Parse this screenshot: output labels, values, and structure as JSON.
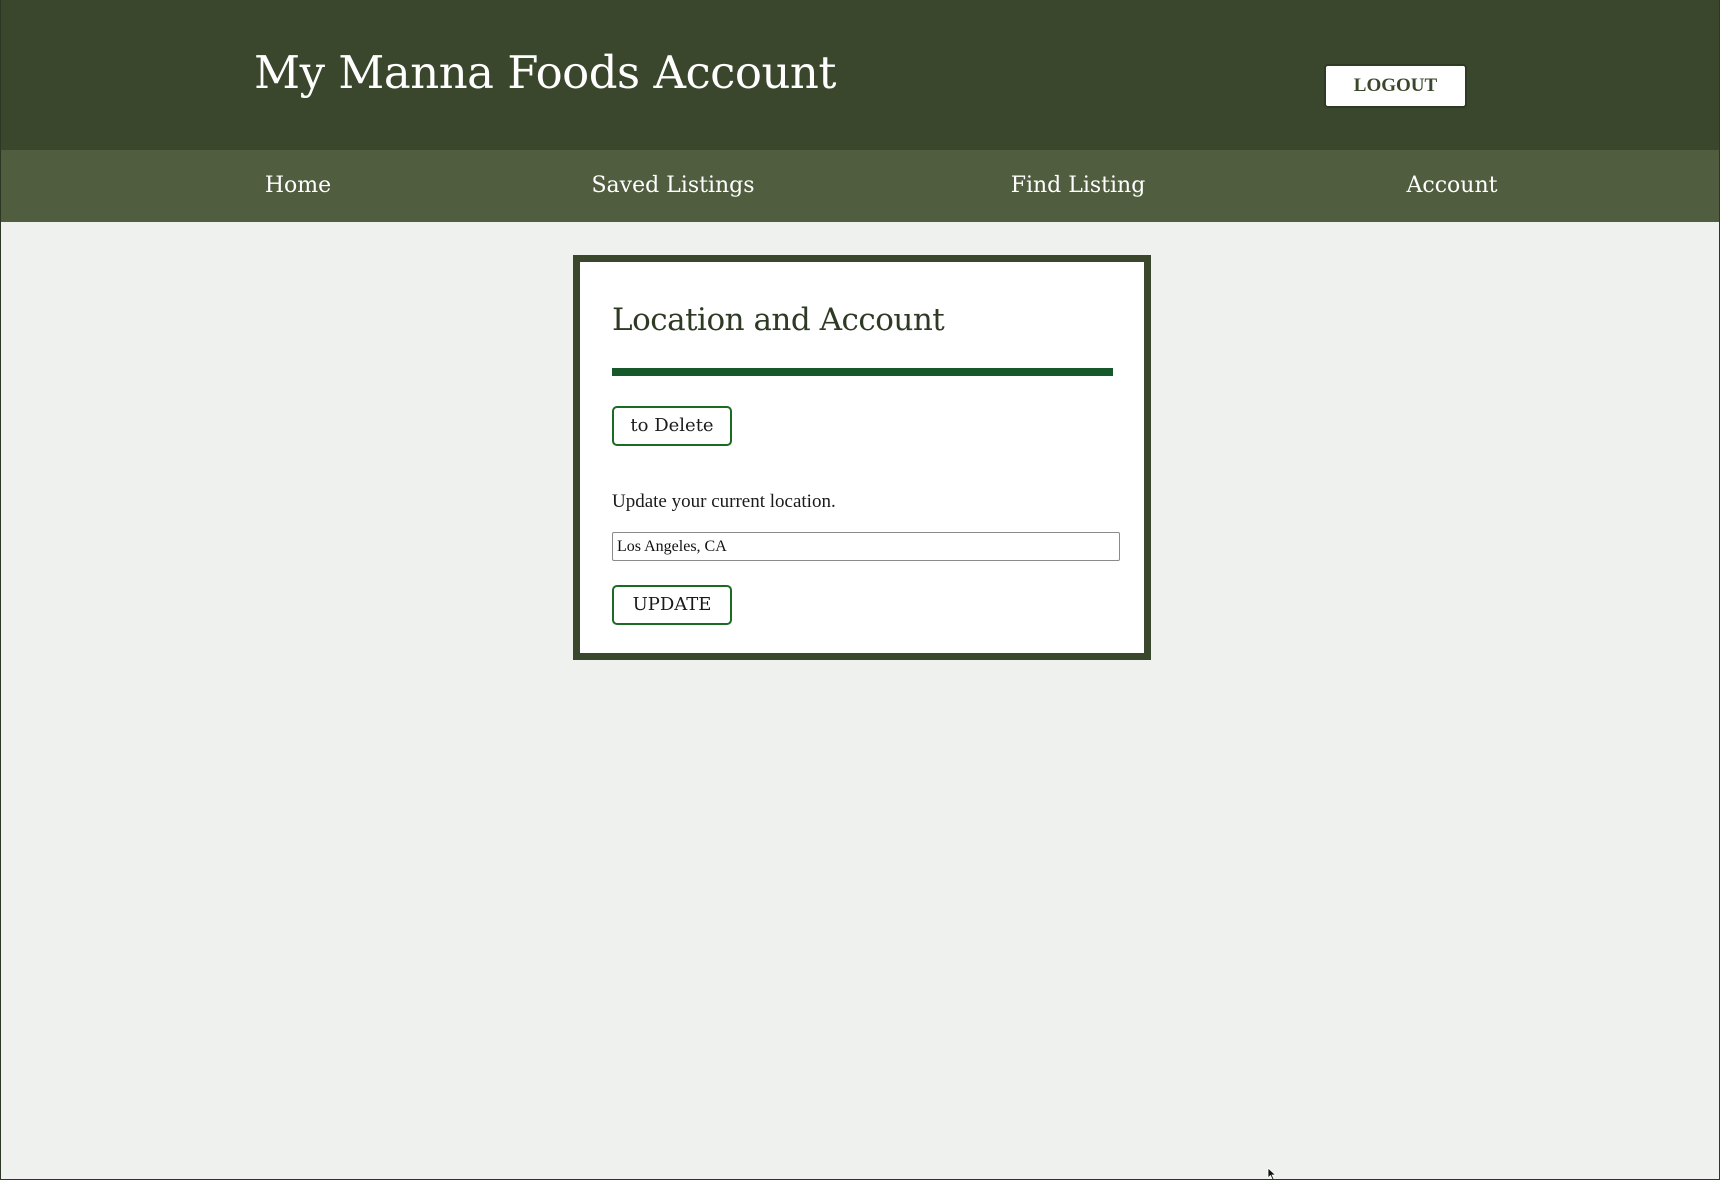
{
  "header": {
    "title": "My Manna Foods Account",
    "logout_label": "LOGOUT"
  },
  "nav": {
    "items": [
      {
        "label": "Home"
      },
      {
        "label": "Saved Listings"
      },
      {
        "label": "Find Listing"
      },
      {
        "label": "Account"
      }
    ]
  },
  "card": {
    "title": "Location and Account",
    "delete_label": "to Delete",
    "location_prompt": "Update your current location.",
    "location_value": "Los Angeles, CA",
    "update_label": "UPDATE"
  },
  "colors": {
    "header_bg": "#3b472c",
    "nav_bg": "#505d3f",
    "page_bg": "#eff1ef",
    "divider": "#17582a",
    "button_border": "#1b6b23"
  },
  "icons": {
    "cursor": "mouse-pointer-icon"
  }
}
